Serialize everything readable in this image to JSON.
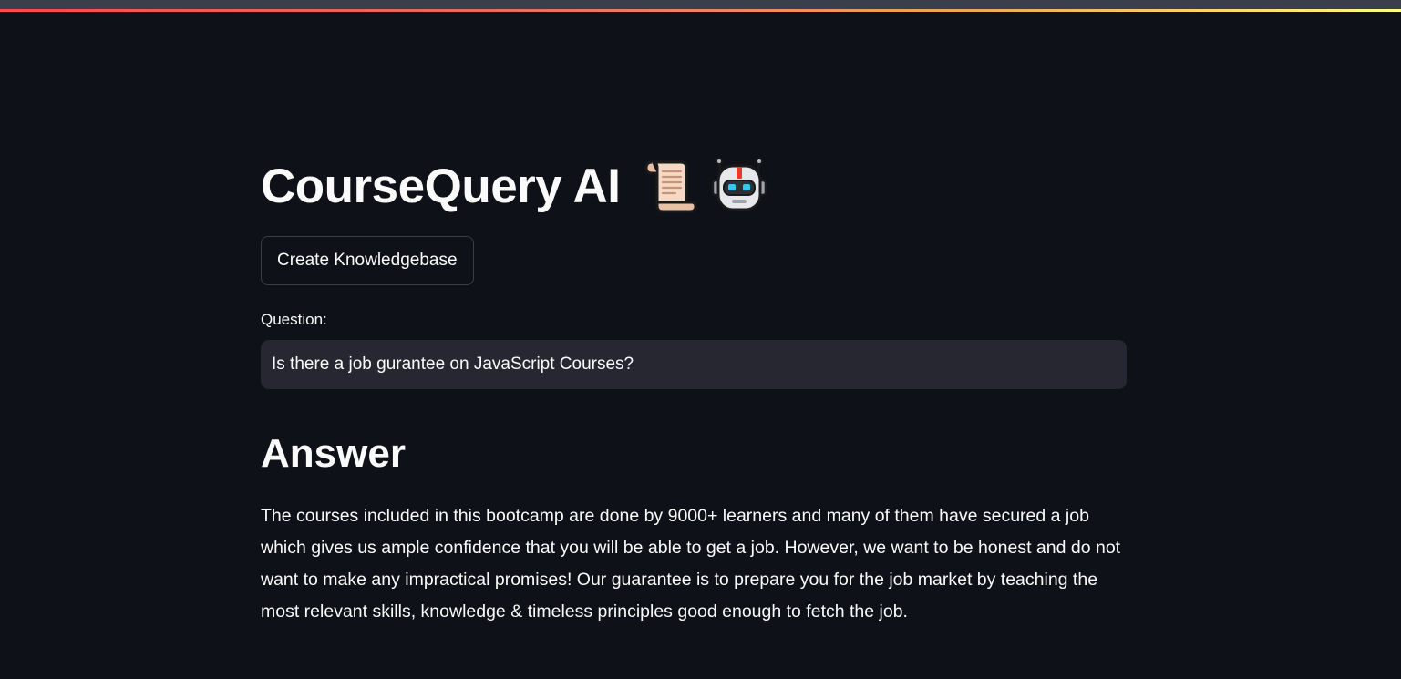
{
  "app": {
    "title": "CourseQuery AI",
    "title_icons": [
      "scroll-icon",
      "robot-icon"
    ]
  },
  "toolbar": {
    "create_kb_label": "Create Knowledgebase"
  },
  "question": {
    "label": "Question:",
    "value": "Is there a job gurantee on JavaScript Courses?"
  },
  "answer": {
    "heading": "Answer",
    "text": "The courses included in this bootcamp are done by 9000+ learners and many of them have secured a job which gives us ample confidence that you will be able to get a job. However, we want to be honest and do not want to make any impractical promises! Our guarantee is to prepare you for the job market by teaching the most relevant skills, knowledge & timeless principles good enough to fetch the job."
  },
  "colors": {
    "background": "#0e1117",
    "input_background": "#262730",
    "text": "#fafafa",
    "button_border": "#3a3d46",
    "top_strip": "#3b3f4b"
  }
}
